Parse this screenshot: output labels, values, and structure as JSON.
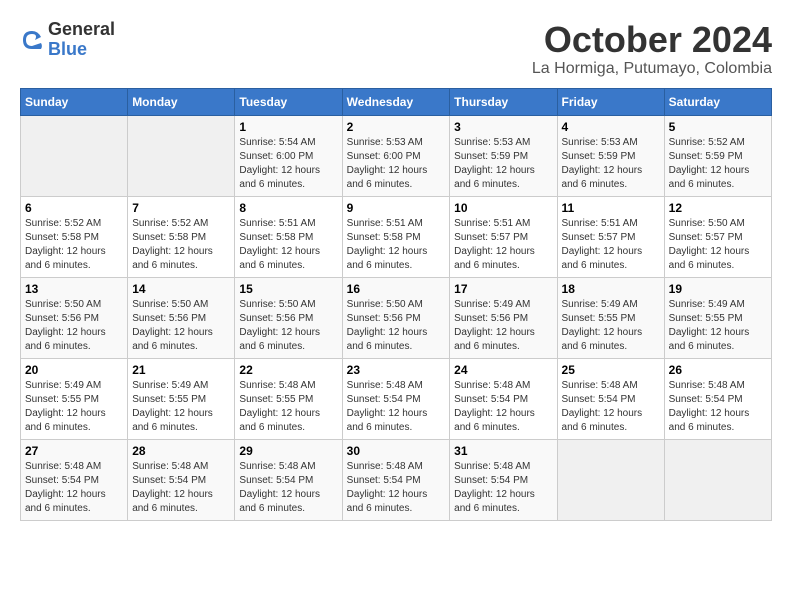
{
  "logo": {
    "line1": "General",
    "line2": "Blue"
  },
  "title": "October 2024",
  "subtitle": "La Hormiga, Putumayo, Colombia",
  "days_of_week": [
    "Sunday",
    "Monday",
    "Tuesday",
    "Wednesday",
    "Thursday",
    "Friday",
    "Saturday"
  ],
  "weeks": [
    [
      {
        "day": "",
        "info": ""
      },
      {
        "day": "",
        "info": ""
      },
      {
        "day": "1",
        "info": "Sunrise: 5:54 AM\nSunset: 6:00 PM\nDaylight: 12 hours\nand 6 minutes."
      },
      {
        "day": "2",
        "info": "Sunrise: 5:53 AM\nSunset: 6:00 PM\nDaylight: 12 hours\nand 6 minutes."
      },
      {
        "day": "3",
        "info": "Sunrise: 5:53 AM\nSunset: 5:59 PM\nDaylight: 12 hours\nand 6 minutes."
      },
      {
        "day": "4",
        "info": "Sunrise: 5:53 AM\nSunset: 5:59 PM\nDaylight: 12 hours\nand 6 minutes."
      },
      {
        "day": "5",
        "info": "Sunrise: 5:52 AM\nSunset: 5:59 PM\nDaylight: 12 hours\nand 6 minutes."
      }
    ],
    [
      {
        "day": "6",
        "info": "Sunrise: 5:52 AM\nSunset: 5:58 PM\nDaylight: 12 hours\nand 6 minutes."
      },
      {
        "day": "7",
        "info": "Sunrise: 5:52 AM\nSunset: 5:58 PM\nDaylight: 12 hours\nand 6 minutes."
      },
      {
        "day": "8",
        "info": "Sunrise: 5:51 AM\nSunset: 5:58 PM\nDaylight: 12 hours\nand 6 minutes."
      },
      {
        "day": "9",
        "info": "Sunrise: 5:51 AM\nSunset: 5:58 PM\nDaylight: 12 hours\nand 6 minutes."
      },
      {
        "day": "10",
        "info": "Sunrise: 5:51 AM\nSunset: 5:57 PM\nDaylight: 12 hours\nand 6 minutes."
      },
      {
        "day": "11",
        "info": "Sunrise: 5:51 AM\nSunset: 5:57 PM\nDaylight: 12 hours\nand 6 minutes."
      },
      {
        "day": "12",
        "info": "Sunrise: 5:50 AM\nSunset: 5:57 PM\nDaylight: 12 hours\nand 6 minutes."
      }
    ],
    [
      {
        "day": "13",
        "info": "Sunrise: 5:50 AM\nSunset: 5:56 PM\nDaylight: 12 hours\nand 6 minutes."
      },
      {
        "day": "14",
        "info": "Sunrise: 5:50 AM\nSunset: 5:56 PM\nDaylight: 12 hours\nand 6 minutes."
      },
      {
        "day": "15",
        "info": "Sunrise: 5:50 AM\nSunset: 5:56 PM\nDaylight: 12 hours\nand 6 minutes."
      },
      {
        "day": "16",
        "info": "Sunrise: 5:50 AM\nSunset: 5:56 PM\nDaylight: 12 hours\nand 6 minutes."
      },
      {
        "day": "17",
        "info": "Sunrise: 5:49 AM\nSunset: 5:56 PM\nDaylight: 12 hours\nand 6 minutes."
      },
      {
        "day": "18",
        "info": "Sunrise: 5:49 AM\nSunset: 5:55 PM\nDaylight: 12 hours\nand 6 minutes."
      },
      {
        "day": "19",
        "info": "Sunrise: 5:49 AM\nSunset: 5:55 PM\nDaylight: 12 hours\nand 6 minutes."
      }
    ],
    [
      {
        "day": "20",
        "info": "Sunrise: 5:49 AM\nSunset: 5:55 PM\nDaylight: 12 hours\nand 6 minutes."
      },
      {
        "day": "21",
        "info": "Sunrise: 5:49 AM\nSunset: 5:55 PM\nDaylight: 12 hours\nand 6 minutes."
      },
      {
        "day": "22",
        "info": "Sunrise: 5:48 AM\nSunset: 5:55 PM\nDaylight: 12 hours\nand 6 minutes."
      },
      {
        "day": "23",
        "info": "Sunrise: 5:48 AM\nSunset: 5:54 PM\nDaylight: 12 hours\nand 6 minutes."
      },
      {
        "day": "24",
        "info": "Sunrise: 5:48 AM\nSunset: 5:54 PM\nDaylight: 12 hours\nand 6 minutes."
      },
      {
        "day": "25",
        "info": "Sunrise: 5:48 AM\nSunset: 5:54 PM\nDaylight: 12 hours\nand 6 minutes."
      },
      {
        "day": "26",
        "info": "Sunrise: 5:48 AM\nSunset: 5:54 PM\nDaylight: 12 hours\nand 6 minutes."
      }
    ],
    [
      {
        "day": "27",
        "info": "Sunrise: 5:48 AM\nSunset: 5:54 PM\nDaylight: 12 hours\nand 6 minutes."
      },
      {
        "day": "28",
        "info": "Sunrise: 5:48 AM\nSunset: 5:54 PM\nDaylight: 12 hours\nand 6 minutes."
      },
      {
        "day": "29",
        "info": "Sunrise: 5:48 AM\nSunset: 5:54 PM\nDaylight: 12 hours\nand 6 minutes."
      },
      {
        "day": "30",
        "info": "Sunrise: 5:48 AM\nSunset: 5:54 PM\nDaylight: 12 hours\nand 6 minutes."
      },
      {
        "day": "31",
        "info": "Sunrise: 5:48 AM\nSunset: 5:54 PM\nDaylight: 12 hours\nand 6 minutes."
      },
      {
        "day": "",
        "info": ""
      },
      {
        "day": "",
        "info": ""
      }
    ]
  ]
}
